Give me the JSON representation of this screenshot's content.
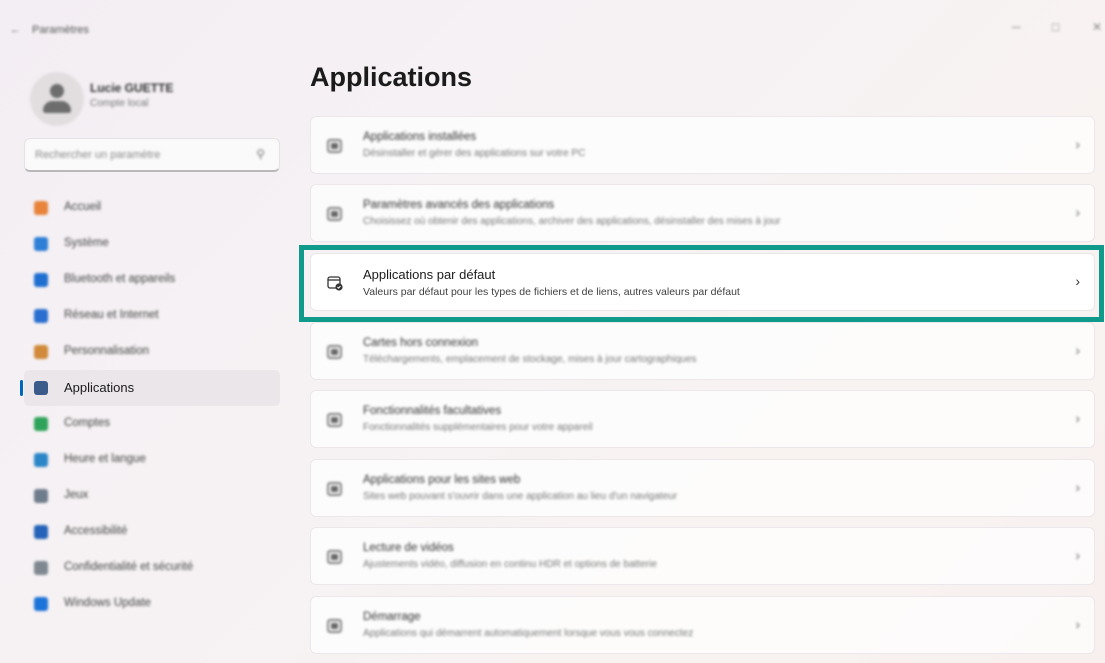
{
  "window": {
    "title": "Paramètres",
    "back_glyph": "←",
    "minimize_glyph": "─",
    "maximize_glyph": "□",
    "close_glyph": "✕"
  },
  "profile": {
    "name": "Lucie GUETTE",
    "account_type": "Compte local"
  },
  "search": {
    "placeholder": "Rechercher un paramètre",
    "icon": "search-icon"
  },
  "sidebar": {
    "items": [
      {
        "label": "Accueil",
        "icon": "home-icon",
        "color": "#e8843b"
      },
      {
        "label": "Système",
        "icon": "system-icon",
        "color": "#2f7fd6"
      },
      {
        "label": "Bluetooth et appareils",
        "icon": "bluetooth-icon",
        "color": "#1f6fd1"
      },
      {
        "label": "Réseau et Internet",
        "icon": "network-icon",
        "color": "#2a6fd0"
      },
      {
        "label": "Personnalisation",
        "icon": "brush-icon",
        "color": "#d08a3a"
      },
      {
        "label": "Applications",
        "icon": "apps-icon",
        "color": "#3c5a8a",
        "active": true
      },
      {
        "label": "Comptes",
        "icon": "accounts-icon",
        "color": "#2fa35a"
      },
      {
        "label": "Heure et langue",
        "icon": "time-language-icon",
        "color": "#2b86c8"
      },
      {
        "label": "Jeux",
        "icon": "gaming-icon",
        "color": "#6f7c8c"
      },
      {
        "label": "Accessibilité",
        "icon": "accessibility-icon",
        "color": "#2563b8"
      },
      {
        "label": "Confidentialité et sécurité",
        "icon": "shield-icon",
        "color": "#7f8790"
      },
      {
        "label": "Windows Update",
        "icon": "update-icon",
        "color": "#1d74d8"
      }
    ]
  },
  "main": {
    "title": "Applications",
    "rows": [
      {
        "title": "Applications installées",
        "subtitle": "Désinstaller et gérer des applications sur votre PC",
        "icon": "installed-apps-icon"
      },
      {
        "title": "Paramètres avancés des applications",
        "subtitle": "Choisissez où obtenir des applications, archiver des applications, désinstaller des mises à jour",
        "icon": "advanced-apps-icon"
      },
      {
        "title": "Applications par défaut",
        "subtitle": "Valeurs par défaut pour les types de fichiers et de liens, autres valeurs par défaut",
        "icon": "default-apps-icon",
        "highlighted": true
      },
      {
        "title": "Cartes hors connexion",
        "subtitle": "Téléchargements, emplacement de stockage, mises à jour cartographiques",
        "icon": "offline-maps-icon"
      },
      {
        "title": "Fonctionnalités facultatives",
        "subtitle": "Fonctionnalités supplémentaires pour votre appareil",
        "icon": "optional-features-icon"
      },
      {
        "title": "Applications pour les sites web",
        "subtitle": "Sites web pouvant s'ouvrir dans une application au lieu d'un navigateur",
        "icon": "web-apps-icon"
      },
      {
        "title": "Lecture de vidéos",
        "subtitle": "Ajustements vidéo, diffusion en continu HDR et options de batterie",
        "icon": "video-playback-icon"
      },
      {
        "title": "Démarrage",
        "subtitle": "Applications qui démarrent automatiquement lorsque vous vous connectez",
        "icon": "startup-icon"
      }
    ],
    "chevron": "›"
  },
  "colors": {
    "accent": "#0067c0",
    "highlight_border": "#0f9a8b"
  }
}
